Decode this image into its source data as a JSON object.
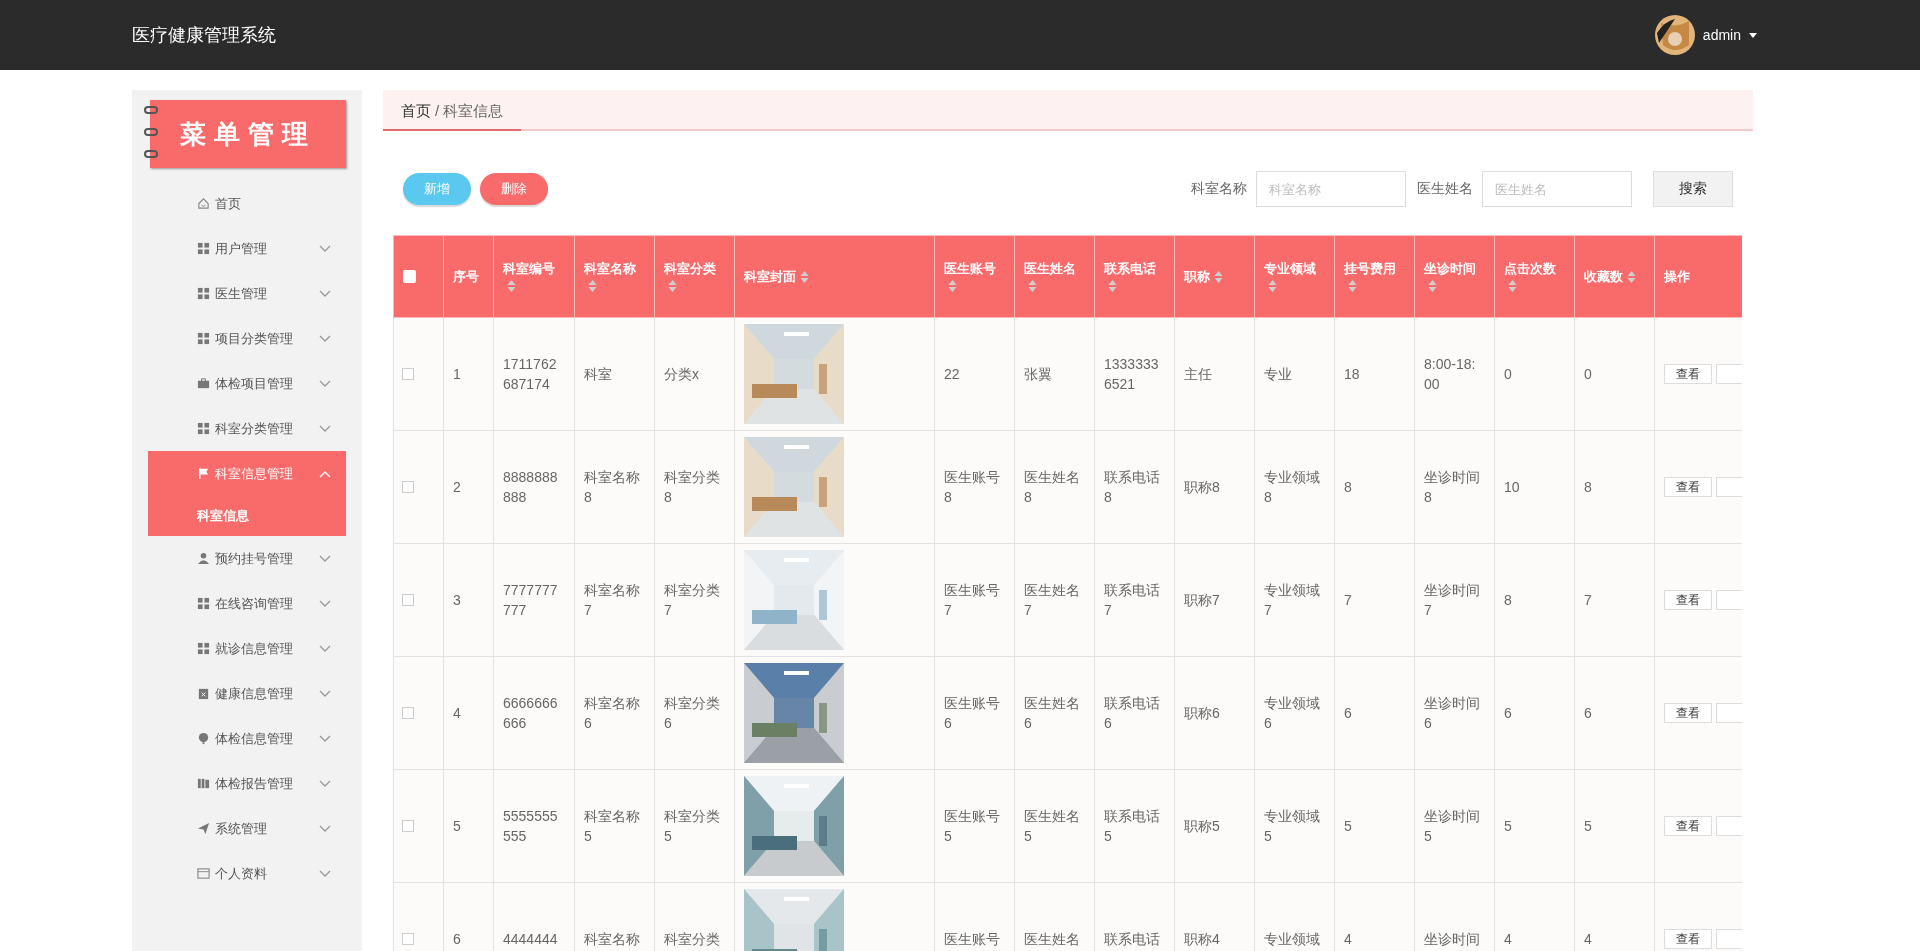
{
  "header": {
    "title": "医疗健康管理系统",
    "user": {
      "name": "admin"
    }
  },
  "sidebar": {
    "logo": "菜单管理",
    "items": [
      {
        "label": "首页",
        "selected": false
      },
      {
        "label": "用户管理",
        "expanded": false,
        "selected": false
      },
      {
        "label": "医生管理",
        "expanded": false,
        "selected": false
      },
      {
        "label": "项目分类管理",
        "expanded": false,
        "selected": false
      },
      {
        "label": "体检项目管理",
        "expanded": false,
        "selected": false
      },
      {
        "label": "科室分类管理",
        "expanded": false,
        "selected": false
      },
      {
        "label": "科室信息管理",
        "expanded": true,
        "selected": true,
        "children": [
          {
            "label": "科室信息",
            "selected": true
          }
        ]
      },
      {
        "label": "预约挂号管理",
        "expanded": false,
        "selected": false
      },
      {
        "label": "在线咨询管理",
        "expanded": false,
        "selected": false
      },
      {
        "label": "就诊信息管理",
        "expanded": false,
        "selected": false
      },
      {
        "label": "健康信息管理",
        "expanded": false,
        "selected": false
      },
      {
        "label": "体检信息管理",
        "expanded": false,
        "selected": false
      },
      {
        "label": "体检报告管理",
        "expanded": false,
        "selected": false
      },
      {
        "label": "系统管理",
        "expanded": false,
        "selected": false
      },
      {
        "label": "个人资料",
        "expanded": false,
        "selected": false
      }
    ]
  },
  "breadcrumb": {
    "items": [
      "首页",
      "科室信息"
    ],
    "separator": "/"
  },
  "toolbar": {
    "buttons": [
      {
        "label": "新增",
        "kind": "add"
      },
      {
        "label": "删除",
        "kind": "delete"
      }
    ],
    "filters": [
      {
        "label": "科室名称",
        "placeholder": "科室名称"
      },
      {
        "label": "医生姓名",
        "placeholder": "医生姓名"
      }
    ],
    "search_button": "搜索"
  },
  "table": {
    "select_all": {
      "checked": false
    },
    "columns": [
      {
        "kind": "text",
        "label": "序号",
        "sortable": false
      },
      {
        "kind": "text",
        "label": "科室编号",
        "sortable": true
      },
      {
        "kind": "text",
        "label": "科室名称",
        "sortable": true
      },
      {
        "kind": "text",
        "label": "科室分类",
        "sortable": true
      },
      {
        "label": "科室封面",
        "sortable": true
      },
      {
        "kind": "text",
        "label": "医生账号",
        "sortable": true
      },
      {
        "kind": "text",
        "label": "医生姓名",
        "sortable": true
      },
      {
        "kind": "text",
        "label": "联系电话",
        "sortable": true
      },
      {
        "kind": "text",
        "label": "职称",
        "sortable": true
      },
      {
        "kind": "text",
        "label": "专业领域",
        "sortable": true
      },
      {
        "kind": "text",
        "label": "挂号费用",
        "sortable": true
      },
      {
        "kind": "text",
        "label": "坐诊时间",
        "sortable": true
      },
      {
        "kind": "text",
        "label": "点击次数",
        "sortable": true
      },
      {
        "kind": "text",
        "label": "收藏数",
        "sortable": true
      },
      {
        "kind": "actions",
        "label": "操作",
        "sortable": false
      }
    ],
    "rows": [
      {
        "selected": false,
        "cells": [
          "1",
          "1711762687174",
          "科室",
          "分类x",
          {
            "kind": "picture"
          },
          "22",
          "张翼",
          "13333336521",
          "主任",
          "专业",
          "18",
          "8:00-18:00",
          "0",
          "0",
          {
            "buttons": [
              "查看"
            ]
          }
        ]
      },
      {
        "selected": false,
        "cells": [
          "2",
          "8888888888",
          "科室名称8",
          "科室分类8",
          {
            "kind": "picture"
          },
          "医生账号8",
          "医生姓名8",
          "联系电话8",
          "职称8",
          "专业领域8",
          "8",
          "坐诊时间8",
          "10",
          "8",
          {
            "buttons": [
              "查看"
            ]
          }
        ]
      },
      {
        "selected": false,
        "cells": [
          "3",
          "7777777777",
          "科室名称7",
          "科室分类7",
          {
            "kind": "picture"
          },
          "医生账号7",
          "医生姓名7",
          "联系电话7",
          "职称7",
          "专业领域7",
          "7",
          "坐诊时间7",
          "8",
          "7",
          {
            "buttons": [
              "查看"
            ]
          }
        ]
      },
      {
        "selected": false,
        "cells": [
          "4",
          "6666666666",
          "科室名称6",
          "科室分类6",
          {
            "kind": "picture"
          },
          "医生账号6",
          "医生姓名6",
          "联系电话6",
          "职称6",
          "专业领域6",
          "6",
          "坐诊时间6",
          "6",
          "6",
          {
            "buttons": [
              "查看"
            ]
          }
        ]
      },
      {
        "selected": false,
        "cells": [
          "5",
          "5555555555",
          "科室名称5",
          "科室分类5",
          {
            "kind": "picture"
          },
          "医生账号5",
          "医生姓名5",
          "联系电话5",
          "职称5",
          "专业领域5",
          "5",
          "坐诊时间5",
          "5",
          "5",
          {
            "buttons": [
              "查看"
            ]
          }
        ]
      },
      {
        "selected": false,
        "cells": [
          "6",
          "4444444",
          "科室名称",
          "科室分类",
          {
            "kind": "picture"
          },
          "医生账号",
          "医生姓名",
          "联系电话",
          "职称4",
          "专业领域",
          "4",
          "坐诊时间",
          "4",
          "4",
          {
            "buttons": [
              "查看"
            ]
          }
        ]
      }
    ]
  }
}
